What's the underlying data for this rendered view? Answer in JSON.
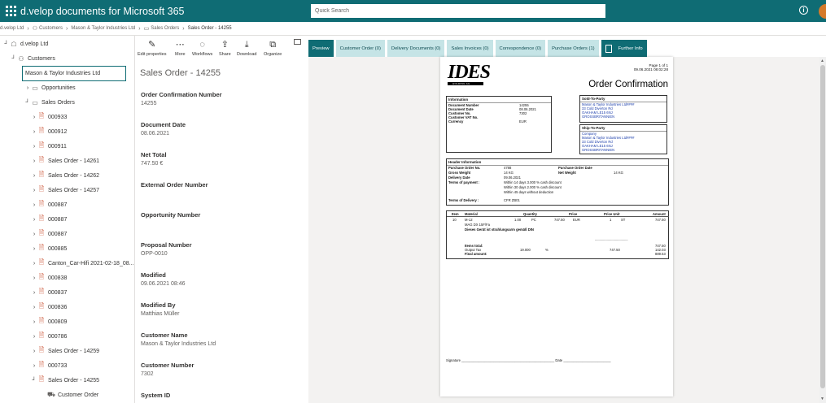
{
  "app": {
    "title": "d.velop documents for Microsoft 365",
    "search_placeholder": "Quick Search"
  },
  "icons": {
    "waffle": "waffle-icon",
    "info": "info-icon",
    "avatar": "avatar"
  },
  "breadcrumb": [
    {
      "label": "d.velop Ltd"
    },
    {
      "label": "Customers"
    },
    {
      "label": "Mason & Taylor Industries Ltd"
    },
    {
      "label": "Sales Orders"
    },
    {
      "label": "Sales Order - 14255"
    }
  ],
  "tree": {
    "items": [
      {
        "label": "d.velop Ltd",
        "chevron": "⌟",
        "icon": "org-icon"
      },
      {
        "label": "Customers",
        "chevron": "⌟",
        "icon": "people-icon"
      },
      {
        "label": "Mason & Taylor Industries Ltd",
        "chevron": "⌟",
        "icon": "none"
      },
      {
        "label": "Opportunities",
        "chevron": "›",
        "icon": "folder-icon"
      },
      {
        "label": "Sales Orders",
        "chevron": "⌟",
        "icon": "folder-icon"
      },
      {
        "label": "000933",
        "chevron": "›",
        "icon": "pdf-icon"
      },
      {
        "label": "000912",
        "chevron": "›",
        "icon": "pdf-icon"
      },
      {
        "label": "000911",
        "chevron": "›",
        "icon": "pdf-icon"
      },
      {
        "label": "Sales Order - 14261",
        "chevron": "›",
        "icon": "pdf-icon"
      },
      {
        "label": "Sales Order - 14262",
        "chevron": "›",
        "icon": "pdf-icon"
      },
      {
        "label": "Sales Order - 14257",
        "chevron": "›",
        "icon": "pdf-icon"
      },
      {
        "label": "000887",
        "chevron": "›",
        "icon": "pdf-icon"
      },
      {
        "label": "000887",
        "chevron": "›",
        "icon": "pdf-icon"
      },
      {
        "label": "000887",
        "chevron": "›",
        "icon": "pdf-icon"
      },
      {
        "label": "000885",
        "chevron": "›",
        "icon": "pdf-icon"
      },
      {
        "label": "Canton_Car-Hifi 2021-02-18_08...",
        "chevron": "›",
        "icon": "pdf-icon"
      },
      {
        "label": "000838",
        "chevron": "›",
        "icon": "pdf-icon"
      },
      {
        "label": "000837",
        "chevron": "›",
        "icon": "pdf-icon"
      },
      {
        "label": "000836",
        "chevron": "›",
        "icon": "pdf-icon"
      },
      {
        "label": "000809",
        "chevron": "›",
        "icon": "pdf-icon"
      },
      {
        "label": "000786",
        "chevron": "›",
        "icon": "pdf-icon"
      },
      {
        "label": "Sales Order - 14259",
        "chevron": "›",
        "icon": "pdf-icon"
      },
      {
        "label": "000733",
        "chevron": "›",
        "icon": "pdf-icon"
      },
      {
        "label": "Sales Order - 14255",
        "chevron": "⌟",
        "icon": "pdf-icon"
      },
      {
        "label": "Customer Order",
        "chevron": "",
        "icon": "cart-icon"
      }
    ]
  },
  "toolbar": {
    "edit_properties": "Edit properties",
    "more": "More",
    "workflows": "Workflows",
    "share": "Share",
    "download": "Download",
    "organize": "Organize"
  },
  "details": {
    "title": "Sales Order - 14255",
    "fields": [
      {
        "label": "Order Confirmation Number",
        "value": "14255"
      },
      {
        "label": "Document Date",
        "value": "08.06.2021"
      },
      {
        "label": "Net Total",
        "value": "747.50 €"
      },
      {
        "label": "External Order Number",
        "value": ""
      },
      {
        "label": "Opportunity Number",
        "value": ""
      },
      {
        "label": "Proposal Number",
        "value": "OPP-0010"
      },
      {
        "label": "Modified",
        "value": "09.06.2021 08:46"
      },
      {
        "label": "Modified By",
        "value": "Matthias Müller"
      },
      {
        "label": "Customer Name",
        "value": "Mason & Taylor Industries Ltd"
      },
      {
        "label": "Customer Number",
        "value": "7302"
      },
      {
        "label": "System ID",
        "value": ""
      }
    ]
  },
  "tabs": [
    {
      "label": "Preview"
    },
    {
      "label": "Customer Order   (0)"
    },
    {
      "label": "Delivery Documents   (0)"
    },
    {
      "label": "Sales Invoices   (0)"
    },
    {
      "label": "Correspondence   (0)"
    },
    {
      "label": "Purchase Orders   (1)"
    },
    {
      "label": "Further Info"
    }
  ],
  "document": {
    "logo": "IDES",
    "logo_sub": "HOLDING AG",
    "page": "Page 1 of 1",
    "printed": "09.06.2021 08:02:28",
    "title": "Order Confirmation",
    "info_header": "Information",
    "info_rows": [
      {
        "k": "Document Number",
        "v": "14255"
      },
      {
        "k": "Document Date",
        "v": "08.06.2021"
      },
      {
        "k": "Customer No.",
        "v": "7302"
      },
      {
        "k": "Customer VAT No.",
        "v": ""
      },
      {
        "k": "Currency",
        "v": "EUR"
      }
    ],
    "sold_header": "Sold-To-Party",
    "sold_lines": [
      "Mason & Taylor Industries Ltd####",
      "33 Cold Diverton Rd",
      "OAKHAM LE15 6NJ",
      "GROSSBRITANNIEN"
    ],
    "ship_header": "Ship-To-Party",
    "ship_lines": [
      "Company",
      "Mason & Taylor Industries Ltd####",
      "33 Cold Diverton Rd",
      "OAKHAM LE15 6NJ",
      "GROSSBRITANNIEN"
    ],
    "header_info_title": "Header Information",
    "po_no_label": "Purchase Order No.",
    "po_no": "4788",
    "po_date_label": "Purchase Order Date",
    "po_date": "",
    "gross_label": "Gross Weight",
    "gross": "14  KG",
    "net_label": "Net Weight",
    "net": "14  KG",
    "delivery_date_label": "Delivery Date",
    "delivery_date": "09.06.2021",
    "terms_label": "Terms of payment :",
    "terms": [
      "Within  14 days 3.000  % cash discount",
      "Within  30 days 2.000  % cash discount",
      "Within  45 days without deduction"
    ],
    "terms_delivery_label": "Terms of Delivery :",
    "terms_delivery": "CFR ZB01",
    "item_headers": {
      "item": "Item",
      "material": "Material",
      "quantity": "Quantity",
      "price": "Price",
      "price_unit": "Price Unit",
      "amount": "Amount"
    },
    "item": {
      "item": "10",
      "material": "M-12",
      "qty": "1.00",
      "unit": "PC",
      "price": "747.50",
      "cur": "EUR",
      "pu": "1",
      "pu_unit": "ST",
      "amount": "747.50"
    },
    "item_desc": "MAG DX 15F/Fa",
    "item_note": "Dieses Gerät ist strahlungsarm gemäß DIN",
    "dashes": "------------------------------------",
    "items_total_label": "Items total:",
    "items_total": "747.50",
    "tax_label": "Output Tax",
    "tax_rate": "19.000",
    "tax_pct": "%",
    "tax_base": "747.50",
    "tax": "142.03",
    "final_label": "Final amount:",
    "final": "889.53",
    "signature": "Signature _________________________________________________ Date _________________________"
  }
}
